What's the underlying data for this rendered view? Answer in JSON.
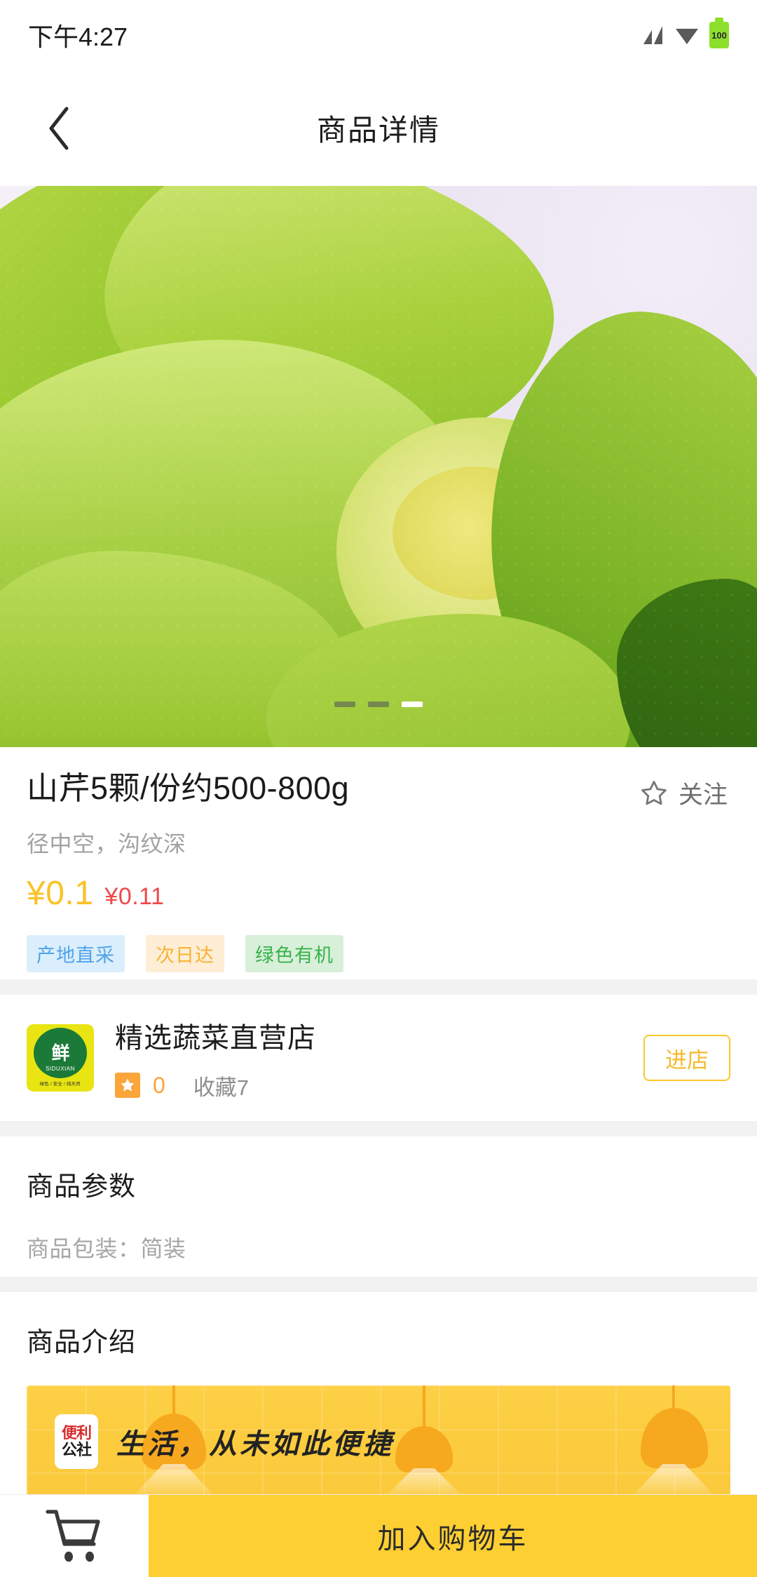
{
  "status_bar": {
    "time": "下午4:27",
    "battery_level": "100",
    "icons": [
      "signal-icon",
      "wifi-icon",
      "battery-icon"
    ]
  },
  "nav": {
    "back_icon": "chevron-left-icon",
    "title": "商品详情"
  },
  "carousel": {
    "slide_count": 3,
    "active_index": 3,
    "alt": "山芹特写图"
  },
  "product": {
    "title": "山芹5颗/份约500-800g",
    "subtitle": "径中空，沟纹深",
    "price_current": "¥0.1",
    "price_original": "¥0.11",
    "follow_label": "关注",
    "follow_icon": "star-outline-icon",
    "tags": [
      {
        "label": "产地直采",
        "style": "blue"
      },
      {
        "label": "次日达",
        "style": "orange"
      },
      {
        "label": "绿色有机",
        "style": "green"
      }
    ]
  },
  "shop": {
    "name": "精选蔬菜直营店",
    "rating": "0",
    "favorites": "收藏7",
    "enter_label": "进店",
    "logo": {
      "mark": "鲜",
      "english": "SIDUXIAN",
      "footer": "绿色 / 安全 / 纯天然"
    }
  },
  "params": {
    "section_title": "商品参数",
    "rows": [
      "商品包装：简装"
    ]
  },
  "intro": {
    "section_title": "商品介绍",
    "banner": {
      "logo_top": "便利",
      "logo_bottom": "公社",
      "slogan": "生活，从未如此便捷"
    }
  },
  "bottom_bar": {
    "cart_icon": "shopping-cart-icon",
    "add_to_cart_label": "加入购物车"
  },
  "colors": {
    "accent_yellow": "#fdcf32",
    "price_yellow": "#fac225",
    "price_red": "#ec4a4d",
    "rating_orange": "#f8a33c",
    "tag_blue": "#4fa3ea",
    "tag_green": "#37b34a",
    "section_gap": "#f2f2f2"
  }
}
